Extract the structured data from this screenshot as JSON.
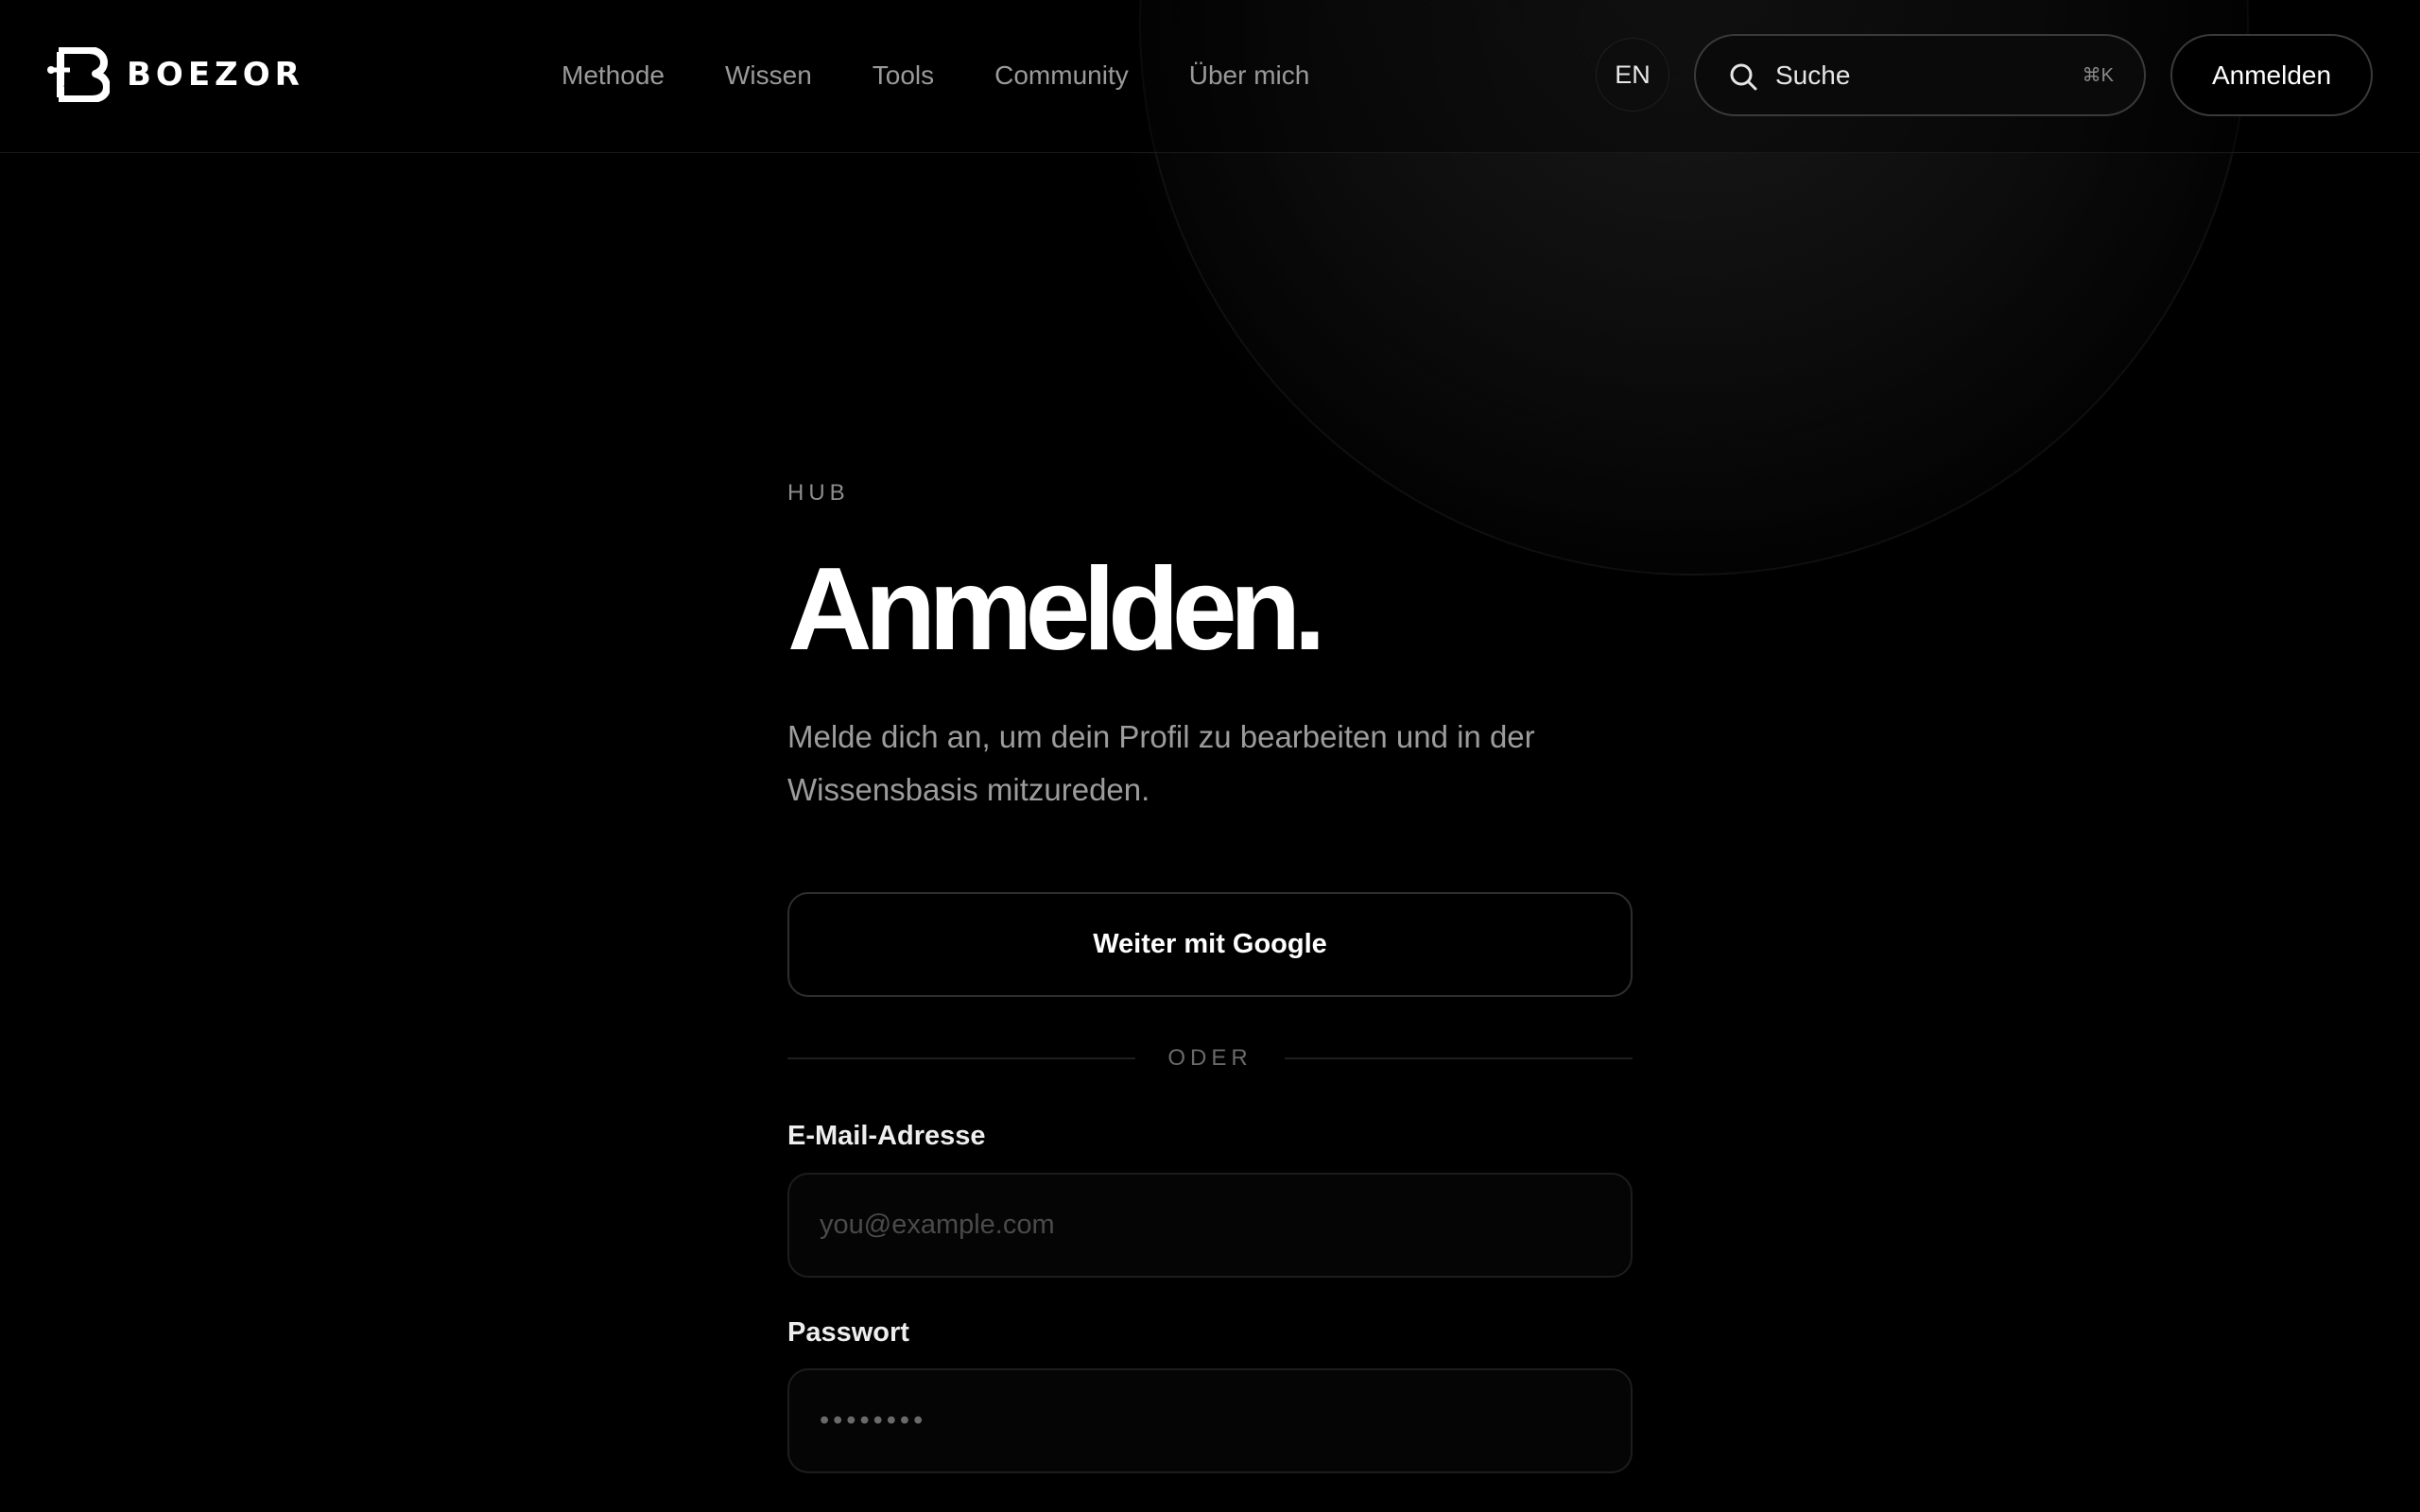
{
  "brand": {
    "name": "BOEZOR"
  },
  "nav": {
    "items": [
      {
        "label": "Methode"
      },
      {
        "label": "Wissen"
      },
      {
        "label": "Tools"
      },
      {
        "label": "Community"
      },
      {
        "label": "Über mich"
      }
    ]
  },
  "header": {
    "language": "EN",
    "search": {
      "label": "Suche",
      "shortcut": "⌘K",
      "icon": "search-icon"
    },
    "login_label": "Anmelden"
  },
  "main": {
    "eyebrow": "HUB",
    "title": "Anmelden.",
    "subtitle": "Melde dich an, um dein Profil zu bearbeiten und in der Wissensbasis mitzureden.",
    "google_button": "Weiter mit Google",
    "divider": "ODER",
    "email": {
      "label": "E-Mail-Adresse",
      "placeholder": "you@example.com",
      "value": ""
    },
    "password": {
      "label": "Passwort",
      "placeholder": "••••••••",
      "value": ""
    }
  },
  "colors": {
    "background": "#000000",
    "text": "#ffffff",
    "muted": "#9a9a9a",
    "border": "#2e2e2e"
  }
}
